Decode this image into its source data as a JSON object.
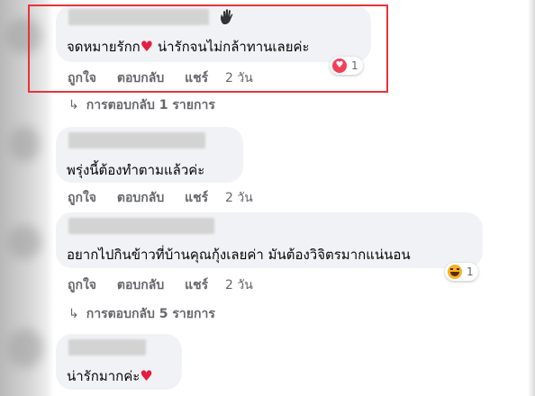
{
  "comments": [
    {
      "text": "จดหมายรักก",
      "text_after_heart": " น่ารักจนไม่กล้าทานเลยค่ะ",
      "actions": {
        "like": "ถูกใจ",
        "reply": "ตอบกลับ",
        "share": "แชร์",
        "time": "2 วัน"
      },
      "reaction": {
        "icon": "heart-reaction-icon",
        "count": "1"
      },
      "replies": "การตอบกลับ 1 รายการ"
    },
    {
      "text": "พรุ่งนี้ต้องทำตามแล้วค่ะ",
      "actions": {
        "like": "ถูกใจ",
        "reply": "ตอบกลับ",
        "share": "แชร์",
        "time": "2 วัน"
      }
    },
    {
      "text": "อยากไปกินข้าวที่บ้านคุณกุ้งเลยค่า มันต้องวิจิตรมากแน่นอน",
      "actions": {
        "like": "ถูกใจ",
        "reply": "ตอบกลับ",
        "share": "แชร์",
        "time": "2 วัน"
      },
      "reaction": {
        "icon": "haha-reaction-icon",
        "count": "1"
      },
      "replies": "การตอบกลับ 5 รายการ"
    },
    {
      "text": "น่ารักมากค่ะ"
    }
  ],
  "colors": {
    "highlight": "#e7333b",
    "bubble": "#f0f2f5",
    "secondary_text": "#65676b",
    "heart": "#e41e3f"
  }
}
